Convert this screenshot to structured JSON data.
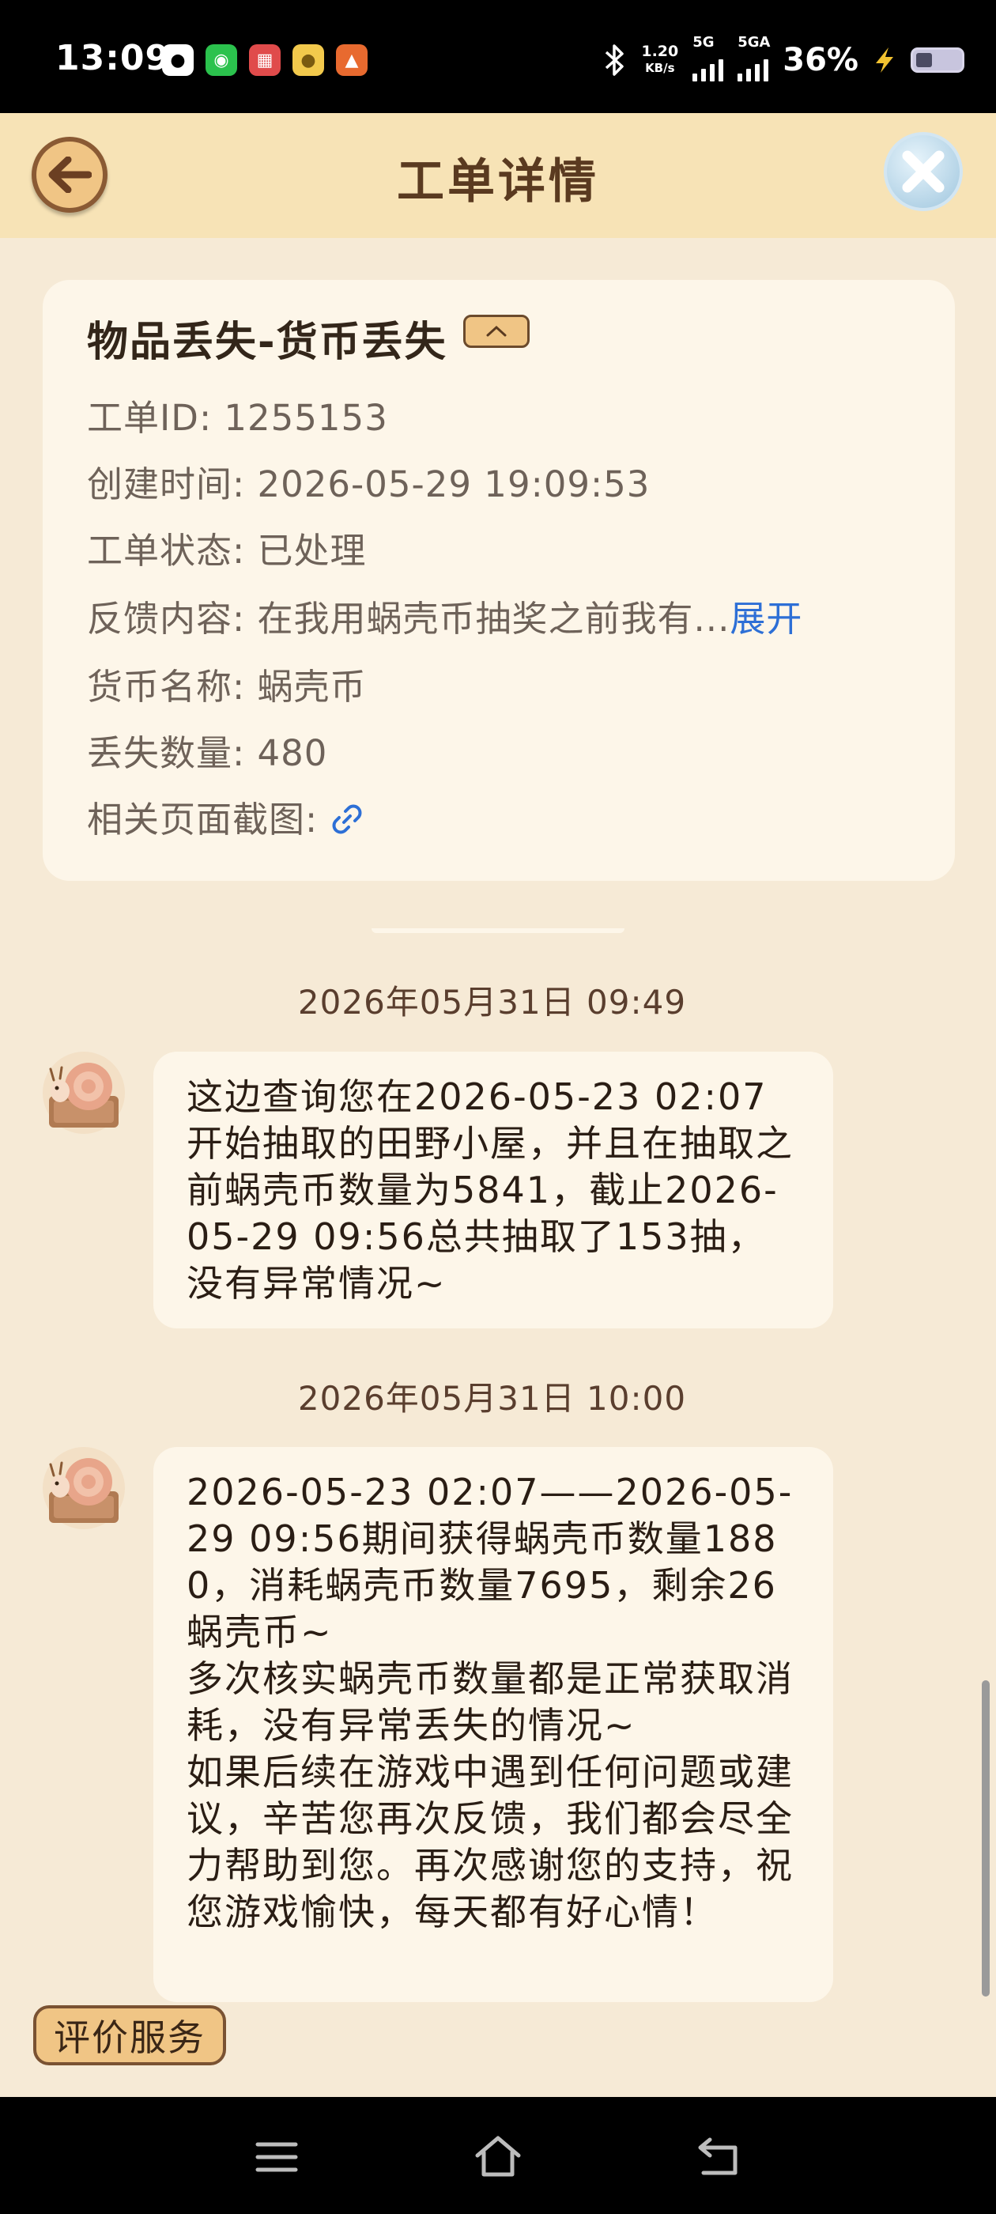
{
  "status_bar": {
    "time": "13:09",
    "app_icons": [
      "qq-icon",
      "wechat-icon",
      "game-app-icon",
      "gourd-app-icon",
      "basket-app-icon"
    ],
    "net_speed_value": "1.20",
    "net_speed_unit": "KB/s",
    "signal1_label": "5G",
    "signal2_label": "5GA",
    "battery_percent": "36%",
    "battery_level": 0.36
  },
  "header": {
    "title": "工单详情",
    "back_icon": "back-arrow-icon",
    "close_icon": "close-icon"
  },
  "ticket": {
    "category": "物品丢失-货币丢失",
    "rows": [
      {
        "label": "工单ID",
        "value": "1255153"
      },
      {
        "label": "创建时间",
        "value": "2026-05-29 19:09:53"
      },
      {
        "label": "工单状态",
        "value": "已处理"
      },
      {
        "label": "反馈内容",
        "value": "在我用蜗壳币抽奖之前我有...",
        "link": "展开"
      },
      {
        "label": "货币名称",
        "value": "蜗壳币"
      },
      {
        "label": "丢失数量",
        "value": "480"
      },
      {
        "label": "相关页面截图",
        "value": ""
      }
    ],
    "colon": ": "
  },
  "messages": [
    {
      "timestamp": "2026年05月31日 09:49",
      "text": "这边查询您在2026-05-23 02:07开始抽取的田野小屋，并且在抽取之前蜗壳币数量为5841，截止2026-05-29 09:56总共抽取了153抽，没有异常情况~"
    },
    {
      "timestamp": "2026年05月31日 10:00",
      "text": "2026-05-23 02:07——2026-05-29 09:56期间获得蜗壳币数量1880，消耗蜗壳币数量7695，剩余26蜗壳币~\n多次核实蜗壳币数量都是正常获取消耗，没有异常丢失的情况~\n如果后续在游戏中遇到任何问题或建议，辛苦您再次反馈，我们都会尽全力帮助到您。再次感谢您的支持，祝您游戏愉快，每天都有好心情！"
    }
  ],
  "rate_button": "评价服务",
  "colors": {
    "background": "#f6ead6",
    "header": "#f7e3b6",
    "card": "#fdf6e9",
    "accent": "#f0c585",
    "link": "#2d6fd6"
  }
}
